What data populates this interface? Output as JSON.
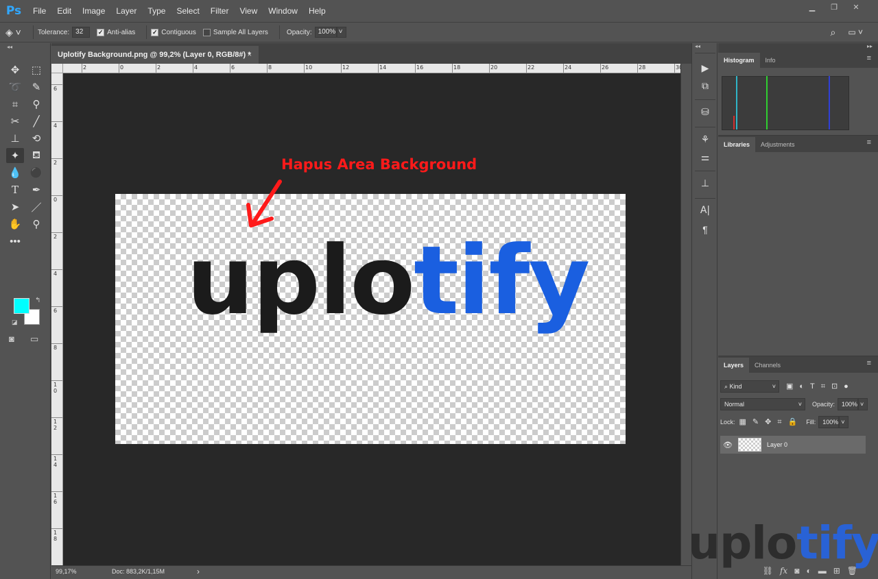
{
  "app": {
    "logo": "Ps"
  },
  "menu": [
    "File",
    "Edit",
    "Image",
    "Layer",
    "Type",
    "Select",
    "Filter",
    "View",
    "Window",
    "Help"
  ],
  "options": {
    "tolerance_label": "Tolerance:",
    "tolerance_value": "32",
    "anti_alias_label": "Anti-alias",
    "contiguous_label": "Contiguous",
    "sample_all_label": "Sample All Layers",
    "opacity_label": "Opacity:",
    "opacity_value": "100%"
  },
  "document": {
    "tab_title": "Uplotify Background.png @ 99,2% (Layer 0, RGB/8#) *",
    "close": "×",
    "logo_dark": "uplo",
    "logo_blue": "tify",
    "annotation": "Hapus Area Background"
  },
  "colors": {
    "foreground": "#00ffff",
    "background": "#ffffff",
    "logo_blue": "#1a5fe0",
    "annotation": "#ff1a1a"
  },
  "ruler_h": [
    "2",
    "0",
    "2",
    "4",
    "6",
    "8",
    "10",
    "12",
    "14",
    "16",
    "18",
    "20",
    "22",
    "24",
    "26",
    "28",
    "30"
  ],
  "ruler_v": [
    "6",
    "4",
    "2",
    "0",
    "2",
    "4",
    "6",
    "8",
    "10",
    "12",
    "14",
    "16",
    "18"
  ],
  "status": {
    "zoom": "99,17%",
    "doc": "Doc: 883,2K/1,15M",
    "arrow": "›"
  },
  "panels": {
    "histogram_tab": "Histogram",
    "info_tab": "Info",
    "libraries_tab": "Libraries",
    "adjustments_tab": "Adjustments",
    "layers_tab": "Layers",
    "channels_tab": "Channels"
  },
  "layers": {
    "filter_kind": "Kind",
    "blend_mode": "Normal",
    "opacity_label": "Opacity:",
    "opacity_value": "100%",
    "lock_label": "Lock:",
    "fill_label": "Fill:",
    "fill_value": "100%",
    "layer_name": "Layer 0"
  },
  "watermark": {
    "dark": "uplo",
    "blue": "tify"
  },
  "icons": [
    "move-icon",
    "marquee-icon",
    "lasso-icon",
    "quick-select-icon",
    "crop-icon",
    "eyedropper-icon",
    "healing-icon",
    "brush-icon",
    "stamp-icon",
    "history-brush-icon",
    "magic-eraser-icon",
    "paint-bucket-icon",
    "blur-icon",
    "dodge-icon",
    "type-icon",
    "pen-icon",
    "path-select-icon",
    "line-icon",
    "hand-icon",
    "zoom-icon",
    "more-tools-icon"
  ]
}
